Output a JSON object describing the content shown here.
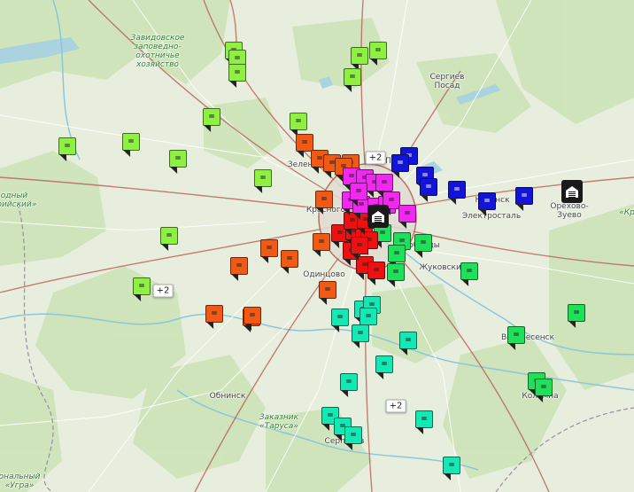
{
  "places": [
    {
      "id": "sergiev",
      "text": "Сергиев\nПосад"
    },
    {
      "id": "zelenograd",
      "text": "Зеленоград"
    },
    {
      "id": "pushkino",
      "text": "Пушк"
    },
    {
      "id": "krasnogorsk",
      "text": "Красного"
    },
    {
      "id": "noginsk",
      "text": "Ногинск"
    },
    {
      "id": "elektrostal",
      "text": "Электросталь"
    },
    {
      "id": "orekhovo",
      "text": "Орехово-\nЗуево"
    },
    {
      "id": "odintsovo",
      "text": "Одинцово"
    },
    {
      "id": "lyubertsy",
      "text": "юберцы"
    },
    {
      "id": "zhukovsky",
      "text": "Жуковский"
    },
    {
      "id": "voskresensk",
      "text": "Воскресенск"
    },
    {
      "id": "kolomna",
      "text": "Коломна"
    },
    {
      "id": "obninsk",
      "text": "Обнинск"
    },
    {
      "id": "serpukhov",
      "text": "Серпухов"
    }
  ],
  "reserves": [
    {
      "id": "zavidovo",
      "text": "Завидовское\nзаповедно-\nохотничье\nхозяйство"
    },
    {
      "id": "tarusa",
      "text": "Заказник\n«Таруса»"
    },
    {
      "id": "west",
      "text": "одный\nарийский»"
    },
    {
      "id": "southwest",
      "text": "ональный\n«Угра»"
    },
    {
      "id": "east",
      "text": "«Кр"
    }
  ],
  "marker_colors": {
    "lime": "#8ef043",
    "green": "#1ee05a",
    "teal": "#14e8b4",
    "orange": "#f05a14",
    "red": "#ee1111",
    "magenta": "#f028f0",
    "blue": "#1414d8"
  },
  "marker_glyph": "=",
  "clusters": [
    {
      "id": "cluster-north",
      "label": "+2"
    },
    {
      "id": "cluster-west",
      "label": "+2"
    },
    {
      "id": "cluster-south",
      "label": "+2"
    }
  ],
  "depots": [
    {
      "id": "depot-orekhovo",
      "icon": "warehouse-icon"
    },
    {
      "id": "depot-moscow",
      "icon": "warehouse-icon"
    }
  ]
}
